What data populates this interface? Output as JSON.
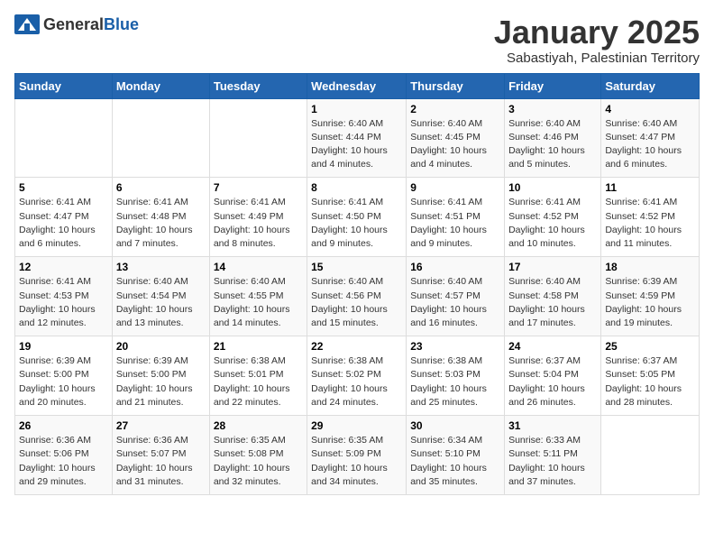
{
  "header": {
    "logo_general": "General",
    "logo_blue": "Blue",
    "month_year": "January 2025",
    "location": "Sabastiyah, Palestinian Territory"
  },
  "weekdays": [
    "Sunday",
    "Monday",
    "Tuesday",
    "Wednesday",
    "Thursday",
    "Friday",
    "Saturday"
  ],
  "weeks": [
    [
      {
        "day": "",
        "info": ""
      },
      {
        "day": "",
        "info": ""
      },
      {
        "day": "",
        "info": ""
      },
      {
        "day": "1",
        "info": "Sunrise: 6:40 AM\nSunset: 4:44 PM\nDaylight: 10 hours\nand 4 minutes."
      },
      {
        "day": "2",
        "info": "Sunrise: 6:40 AM\nSunset: 4:45 PM\nDaylight: 10 hours\nand 4 minutes."
      },
      {
        "day": "3",
        "info": "Sunrise: 6:40 AM\nSunset: 4:46 PM\nDaylight: 10 hours\nand 5 minutes."
      },
      {
        "day": "4",
        "info": "Sunrise: 6:40 AM\nSunset: 4:47 PM\nDaylight: 10 hours\nand 6 minutes."
      }
    ],
    [
      {
        "day": "5",
        "info": "Sunrise: 6:41 AM\nSunset: 4:47 PM\nDaylight: 10 hours\nand 6 minutes."
      },
      {
        "day": "6",
        "info": "Sunrise: 6:41 AM\nSunset: 4:48 PM\nDaylight: 10 hours\nand 7 minutes."
      },
      {
        "day": "7",
        "info": "Sunrise: 6:41 AM\nSunset: 4:49 PM\nDaylight: 10 hours\nand 8 minutes."
      },
      {
        "day": "8",
        "info": "Sunrise: 6:41 AM\nSunset: 4:50 PM\nDaylight: 10 hours\nand 9 minutes."
      },
      {
        "day": "9",
        "info": "Sunrise: 6:41 AM\nSunset: 4:51 PM\nDaylight: 10 hours\nand 9 minutes."
      },
      {
        "day": "10",
        "info": "Sunrise: 6:41 AM\nSunset: 4:52 PM\nDaylight: 10 hours\nand 10 minutes."
      },
      {
        "day": "11",
        "info": "Sunrise: 6:41 AM\nSunset: 4:52 PM\nDaylight: 10 hours\nand 11 minutes."
      }
    ],
    [
      {
        "day": "12",
        "info": "Sunrise: 6:41 AM\nSunset: 4:53 PM\nDaylight: 10 hours\nand 12 minutes."
      },
      {
        "day": "13",
        "info": "Sunrise: 6:40 AM\nSunset: 4:54 PM\nDaylight: 10 hours\nand 13 minutes."
      },
      {
        "day": "14",
        "info": "Sunrise: 6:40 AM\nSunset: 4:55 PM\nDaylight: 10 hours\nand 14 minutes."
      },
      {
        "day": "15",
        "info": "Sunrise: 6:40 AM\nSunset: 4:56 PM\nDaylight: 10 hours\nand 15 minutes."
      },
      {
        "day": "16",
        "info": "Sunrise: 6:40 AM\nSunset: 4:57 PM\nDaylight: 10 hours\nand 16 minutes."
      },
      {
        "day": "17",
        "info": "Sunrise: 6:40 AM\nSunset: 4:58 PM\nDaylight: 10 hours\nand 17 minutes."
      },
      {
        "day": "18",
        "info": "Sunrise: 6:39 AM\nSunset: 4:59 PM\nDaylight: 10 hours\nand 19 minutes."
      }
    ],
    [
      {
        "day": "19",
        "info": "Sunrise: 6:39 AM\nSunset: 5:00 PM\nDaylight: 10 hours\nand 20 minutes."
      },
      {
        "day": "20",
        "info": "Sunrise: 6:39 AM\nSunset: 5:00 PM\nDaylight: 10 hours\nand 21 minutes."
      },
      {
        "day": "21",
        "info": "Sunrise: 6:38 AM\nSunset: 5:01 PM\nDaylight: 10 hours\nand 22 minutes."
      },
      {
        "day": "22",
        "info": "Sunrise: 6:38 AM\nSunset: 5:02 PM\nDaylight: 10 hours\nand 24 minutes."
      },
      {
        "day": "23",
        "info": "Sunrise: 6:38 AM\nSunset: 5:03 PM\nDaylight: 10 hours\nand 25 minutes."
      },
      {
        "day": "24",
        "info": "Sunrise: 6:37 AM\nSunset: 5:04 PM\nDaylight: 10 hours\nand 26 minutes."
      },
      {
        "day": "25",
        "info": "Sunrise: 6:37 AM\nSunset: 5:05 PM\nDaylight: 10 hours\nand 28 minutes."
      }
    ],
    [
      {
        "day": "26",
        "info": "Sunrise: 6:36 AM\nSunset: 5:06 PM\nDaylight: 10 hours\nand 29 minutes."
      },
      {
        "day": "27",
        "info": "Sunrise: 6:36 AM\nSunset: 5:07 PM\nDaylight: 10 hours\nand 31 minutes."
      },
      {
        "day": "28",
        "info": "Sunrise: 6:35 AM\nSunset: 5:08 PM\nDaylight: 10 hours\nand 32 minutes."
      },
      {
        "day": "29",
        "info": "Sunrise: 6:35 AM\nSunset: 5:09 PM\nDaylight: 10 hours\nand 34 minutes."
      },
      {
        "day": "30",
        "info": "Sunrise: 6:34 AM\nSunset: 5:10 PM\nDaylight: 10 hours\nand 35 minutes."
      },
      {
        "day": "31",
        "info": "Sunrise: 6:33 AM\nSunset: 5:11 PM\nDaylight: 10 hours\nand 37 minutes."
      },
      {
        "day": "",
        "info": ""
      }
    ]
  ]
}
